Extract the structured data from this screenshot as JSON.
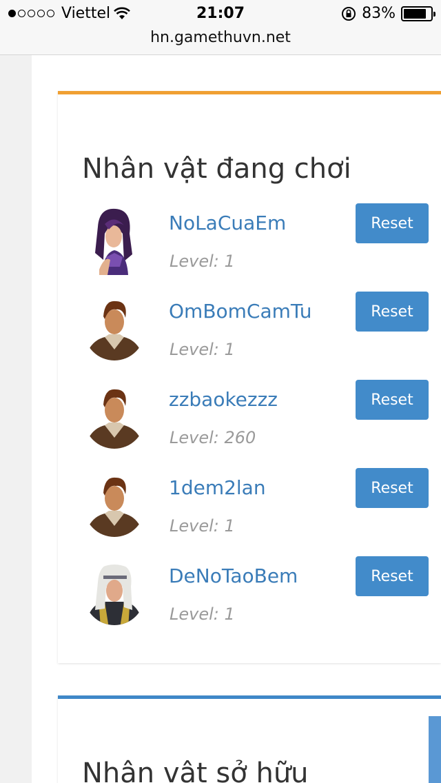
{
  "status_bar": {
    "carrier": "Viettel",
    "time": "21:07",
    "battery": "83%"
  },
  "browser": {
    "url": "hn.gamethuvn.net"
  },
  "panel_playing": {
    "title": "Nhân vật đang chơi",
    "accent": "#f0a032",
    "characters": [
      {
        "name": "NoLaCuaEm",
        "level": "Level: 1",
        "avatar": "female-purple-avatar",
        "button": "Reset"
      },
      {
        "name": "OmBomCamTu",
        "level": "Level: 1",
        "avatar": "male-warrior-avatar",
        "button": "Reset"
      },
      {
        "name": "zzbaokezzz",
        "level": "Level: 260",
        "avatar": "male-warrior-avatar",
        "button": "Reset"
      },
      {
        "name": "1dem2lan",
        "level": "Level: 1",
        "avatar": "male-warrior-avatar",
        "button": "Reset"
      },
      {
        "name": "DeNoTaoBem",
        "level": "Level: 1",
        "avatar": "white-hair-avatar",
        "button": "Reset"
      }
    ]
  },
  "panel_owned": {
    "title": "Nhân vật sở hữu",
    "accent": "#3f88c8"
  }
}
